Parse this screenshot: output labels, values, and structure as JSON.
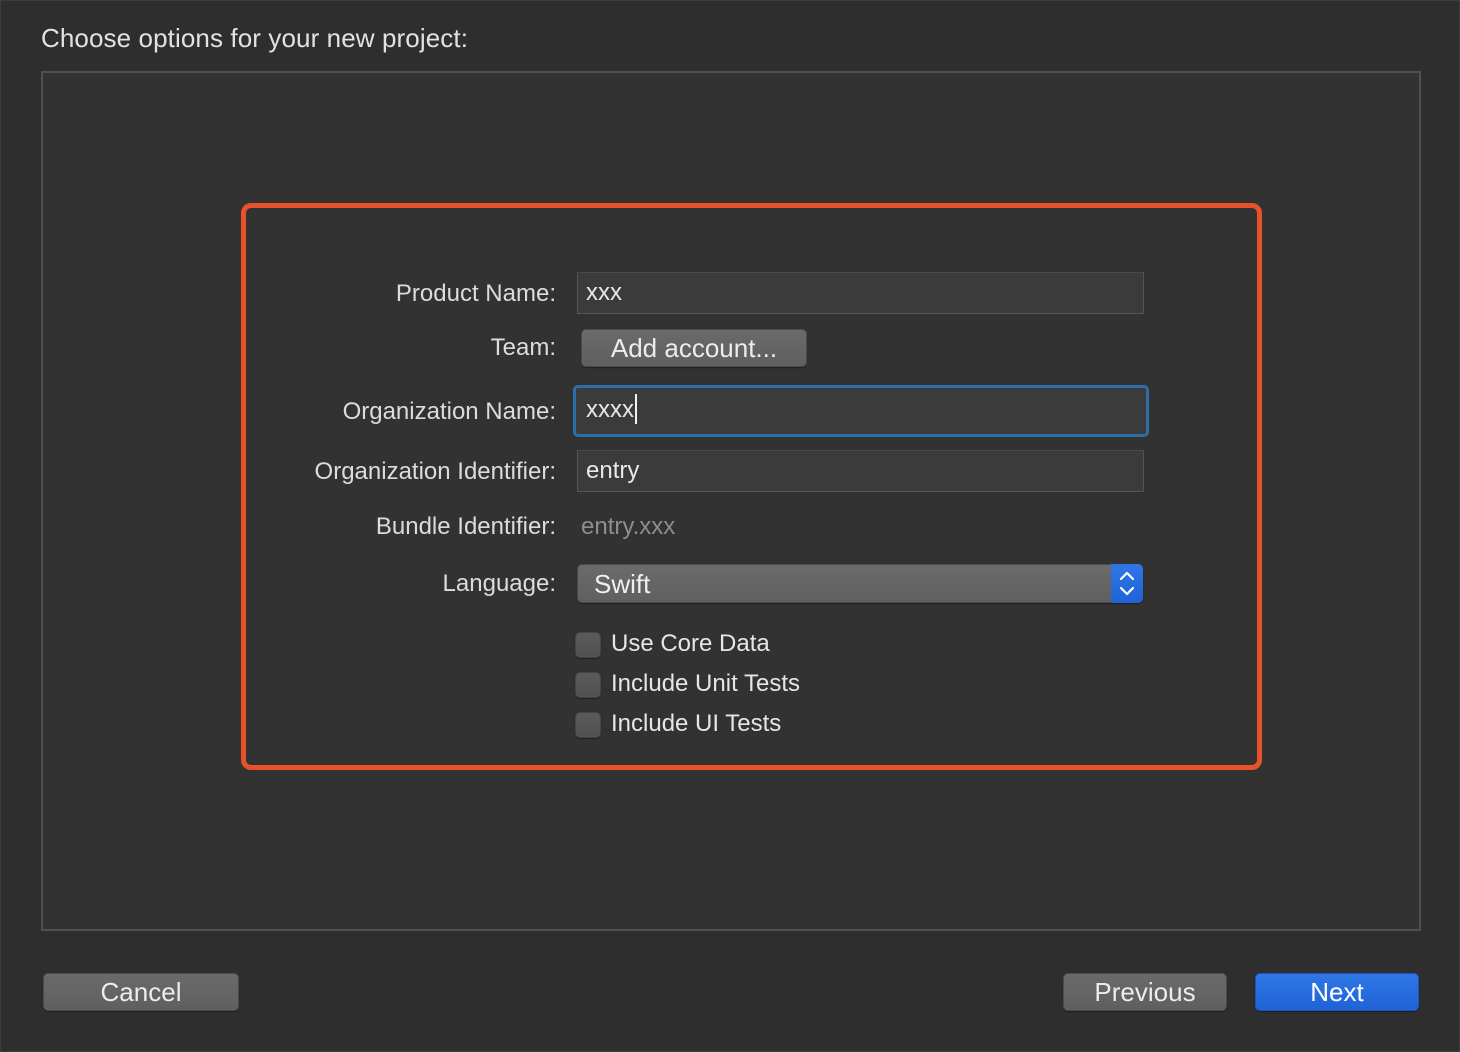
{
  "dialog": {
    "heading": "Choose options for your new project:"
  },
  "form": {
    "product_name": {
      "label": "Product Name:",
      "value": "xxx"
    },
    "team": {
      "label": "Team:",
      "button": "Add account..."
    },
    "organization_name": {
      "label": "Organization Name:",
      "value": "xxxx"
    },
    "organization_identifier": {
      "label": "Organization Identifier:",
      "value": "entry"
    },
    "bundle_identifier": {
      "label": "Bundle Identifier:",
      "value": "entry.xxx"
    },
    "language": {
      "label": "Language:",
      "selected": "Swift"
    },
    "checkboxes": [
      {
        "label": "Use Core Data",
        "checked": false
      },
      {
        "label": "Include Unit Tests",
        "checked": false
      },
      {
        "label": "Include UI Tests",
        "checked": false
      }
    ]
  },
  "footer": {
    "cancel": "Cancel",
    "previous": "Previous",
    "next": "Next"
  },
  "colors": {
    "highlight_border": "#e8522a",
    "accent": "#1f63d6",
    "focus_ring": "#2e6ea8"
  }
}
